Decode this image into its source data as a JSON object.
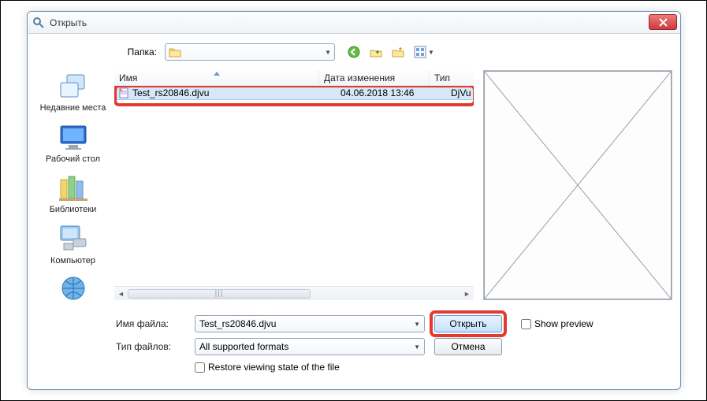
{
  "title": "Открыть",
  "toprow": {
    "folder_label": "Папка:",
    "folder_value": ""
  },
  "columns": {
    "name": "Имя",
    "date": "Дата изменения",
    "type": "Тип"
  },
  "files": [
    {
      "name": "Test_rs20846.djvu",
      "date": "04.06.2018 13:46",
      "type": "DjVu Doc."
    }
  ],
  "places": {
    "recent": "Недавние места",
    "desktop": "Рабочий стол",
    "libraries": "Библиотеки",
    "computer": "Компьютер"
  },
  "bottom": {
    "filename_label": "Имя файла:",
    "filename_value": "Test_rs20846.djvu",
    "filetype_label": "Тип файлов:",
    "filetype_value": "All supported formats",
    "open": "Открыть",
    "cancel": "Отмена",
    "restore": "Restore viewing state of the file",
    "showpreview": "Show preview"
  }
}
